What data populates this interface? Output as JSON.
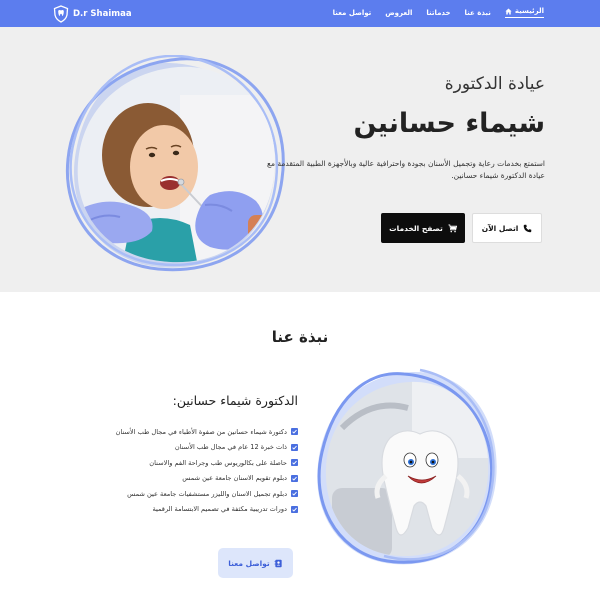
{
  "navbar": {
    "brand": "D.r Shaimaa",
    "items": [
      {
        "label": "الرئيسية",
        "icon": "home-icon",
        "active": true
      },
      {
        "label": "نبذة عنا"
      },
      {
        "label": "خدماتنا"
      },
      {
        "label": "العروض"
      },
      {
        "label": "تواصل معنا"
      }
    ]
  },
  "hero": {
    "subtitle": "عيادة الدكتورة",
    "title": "شيماء حسانين",
    "description": "استمتع بخدمات رعاية وتجميل الأسنان بجودة واحترافية عالية وبالأجهزة الطبية المتقدمة مع عيادة الدكتورة شيماء حسانين.",
    "call_button": "اتصل الآن",
    "services_button": "تصفح الخدمات",
    "image_alt": "dentist examining child"
  },
  "about": {
    "heading": "نبذة عنا",
    "title": "الدكتورة شيماء حسانين:",
    "items": [
      "دكتورة شيماء حسانين من صفوة الأطباء في مجال طب الأسنان",
      "ذات خبرة 12 عام في مجال طب الأسنان",
      "حاصلة على بكالوريوس طب وجراحة الفم والاسنان",
      "دبلوم تقويم الاسنان جامعة عين شمس",
      "دبلوم تجميل الاسنان والليزر مستشفيات جامعة عين شمس",
      "دورات تدريبية مكثفة في تصميم الابتسامة الرقمية"
    ],
    "contact_button": "تواصل معنا"
  },
  "colors": {
    "accent": "#5c7dee",
    "hero_bg": "#efefef",
    "check": "#4a6fe0",
    "dark": "#0d0d0d"
  }
}
